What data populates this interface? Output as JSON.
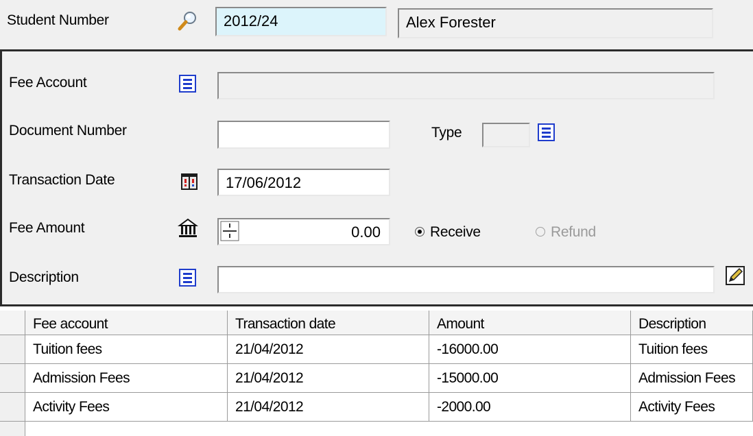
{
  "student": {
    "label": "Student Number",
    "number": "2012/24",
    "name": "Alex Forester"
  },
  "form": {
    "fee_account_label": "Fee Account",
    "fee_account_value": "",
    "document_number_label": "Document Number",
    "document_number_value": "",
    "type_label": "Type",
    "type_value": "",
    "transaction_date_label": "Transaction Date",
    "transaction_date_value": "17/06/2012",
    "fee_amount_label": "Fee Amount",
    "fee_amount_value": "0.00",
    "receive_label": "Receive",
    "refund_label": "Refund",
    "selected_mode": "Receive",
    "description_label": "Description",
    "description_value": ""
  },
  "table": {
    "columns": [
      "Fee account",
      "Transaction date",
      "Amount",
      "Description"
    ],
    "rows": [
      [
        "Tuition fees",
        "21/04/2012",
        "-16000.00",
        "Tuition fees"
      ],
      [
        "Admission Fees",
        "21/04/2012",
        "-15000.00",
        "Admission Fees"
      ],
      [
        "Activity Fees",
        "21/04/2012",
        "-2000.00",
        "Activity Fees"
      ]
    ]
  },
  "icons": {
    "search": "magnifier-icon",
    "list": "list-icon",
    "calendar": "calendar-icon",
    "currency": "bank-icon",
    "stepper": "stepper-icon",
    "edit": "edit-pencil-icon"
  },
  "colors": {
    "highlight_field": "#dcf4fb",
    "list_icon_blue": "#1e3ccc",
    "panel_bg": "#f0f0f0"
  }
}
